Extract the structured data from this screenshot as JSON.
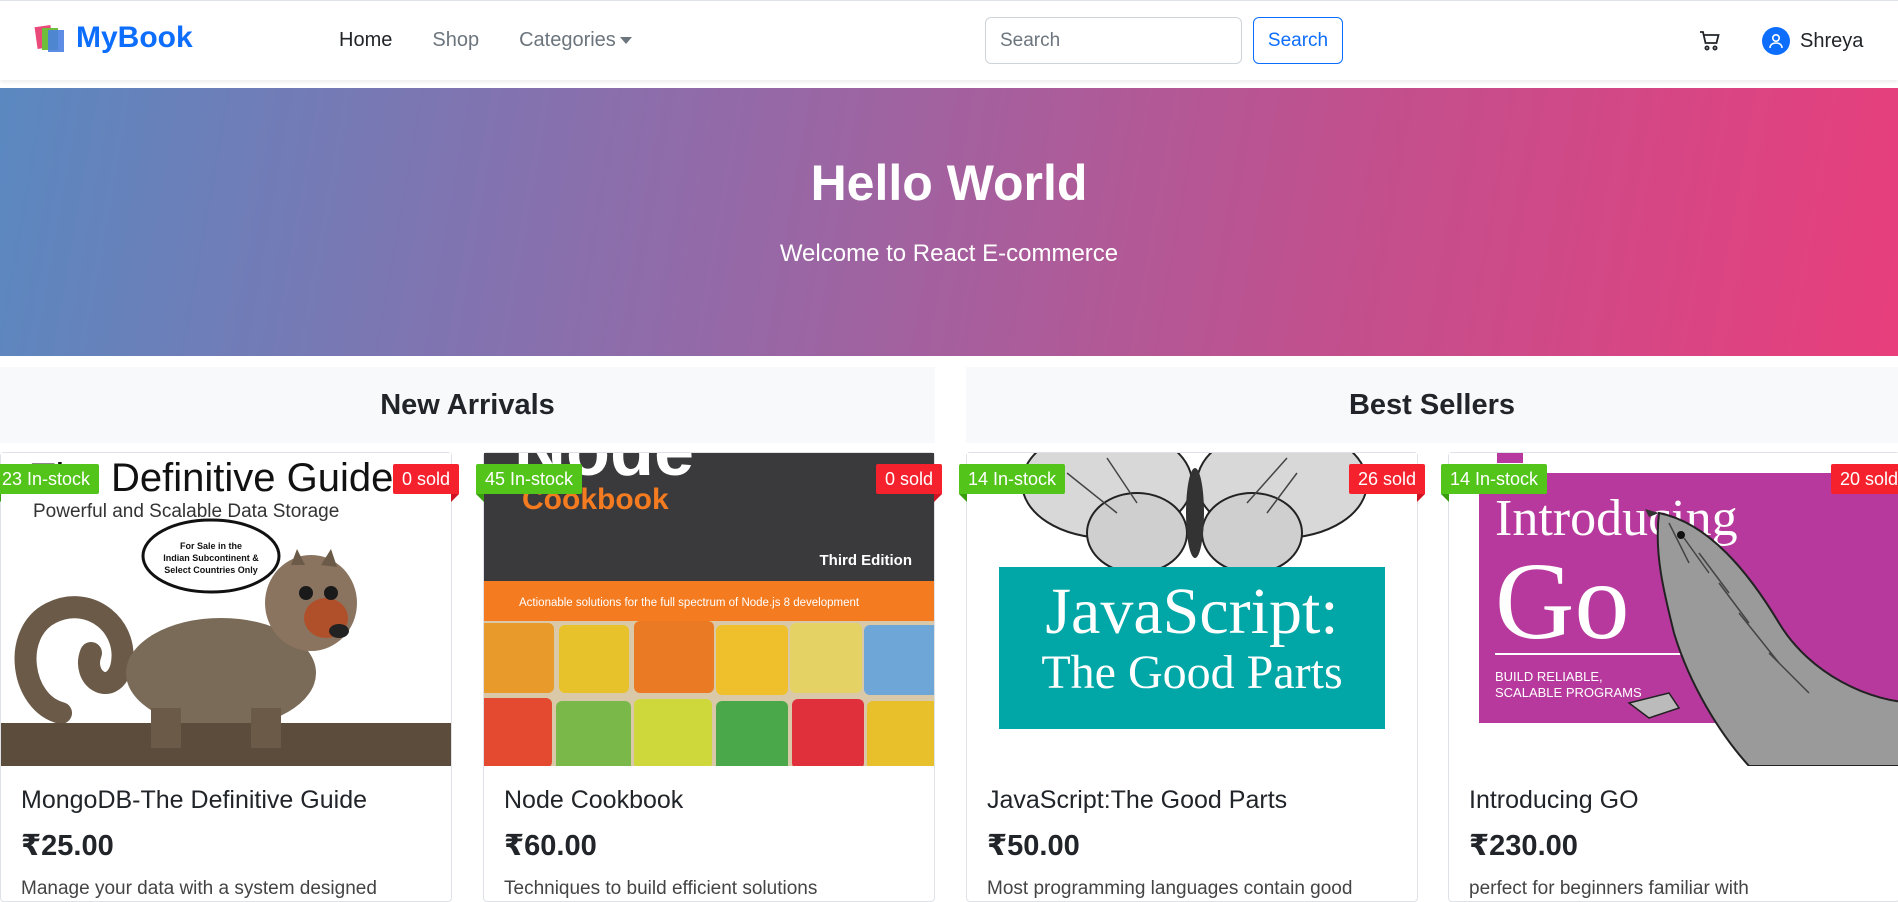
{
  "navbar": {
    "brand": "MyBook",
    "links": [
      {
        "label": "Home",
        "active": true
      },
      {
        "label": "Shop",
        "active": false
      },
      {
        "label": "Categories",
        "active": false
      }
    ],
    "search_placeholder": "Search",
    "search_button": "Search",
    "cart_icon": "cart-icon",
    "user_name": "Shreya"
  },
  "hero": {
    "title": "Hello World",
    "subtitle": "Welcome to React E-commerce"
  },
  "sections": {
    "left": "New Arrivals",
    "right": "Best Sellers"
  },
  "products": [
    {
      "stock": "23 In-stock",
      "sold": "0 sold",
      "title": "MongoDB-The Definitive Guide",
      "price": "₹25.00",
      "description": "Manage your data with a system designed",
      "cover": {
        "heading": "The Definitive Guide",
        "subheading": "Powerful and Scalable Data Storage",
        "stamp": "For Sale in the Indian Subcontinent & Select Countries Only"
      }
    },
    {
      "stock": "45 In-stock",
      "sold": "0 sold",
      "title": "Node Cookbook",
      "price": "₹60.00",
      "description": "Techniques to build efficient solutions",
      "cover": {
        "heading": "Node",
        "subheading": "Cookbook",
        "edition": "Third Edition",
        "tagline": "Actionable solutions for the full spectrum of Node.js 8 development"
      }
    },
    {
      "stock": "14 In-stock",
      "sold": "26 sold",
      "title": "JavaScript:The Good Parts",
      "price": "₹50.00",
      "description": "Most programming languages contain good",
      "cover": {
        "line1": "JavaScript:",
        "line2": "The Good Parts"
      }
    },
    {
      "stock": "14 In-stock",
      "sold": "20 sold",
      "title": "Introducing GO",
      "price": "₹230.00",
      "description": "perfect for beginners familiar with",
      "cover": {
        "line1": "Introducing",
        "line2": "Go",
        "tagline": "BUILD RELIABLE, SCALABLE PROGRAMS"
      }
    }
  ],
  "colors": {
    "primary": "#0d6efd",
    "in_stock": "#52c41a",
    "sold": "#f5222d",
    "hero_start": "#5b88c0",
    "hero_end": "#e83e7c"
  }
}
